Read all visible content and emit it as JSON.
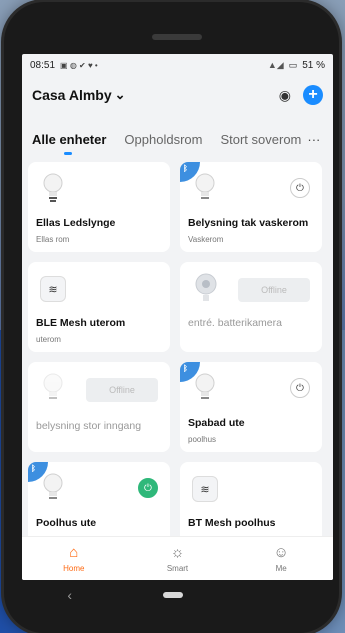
{
  "status": {
    "time": "08:51",
    "notification_icons": "▣ ◍ ✔ ♥ •",
    "signal": "📶",
    "battery": "51 %"
  },
  "header": {
    "home_name": "Casa Almby",
    "chevron": "⌄",
    "location_icon": "◉",
    "add_icon": "+"
  },
  "tabs": [
    {
      "label": "Alle enheter",
      "active": true
    },
    {
      "label": "Oppholdsrom",
      "active": false
    },
    {
      "label": "Stort soverom",
      "active": false
    }
  ],
  "tabs_more": "···",
  "devices": [
    {
      "name": "Ellas Ledslynge",
      "room": "Ellas rom",
      "type": "bulb",
      "bt": false,
      "state": "none"
    },
    {
      "name": "Belysning tak vaskerom",
      "room": "Vaskerom",
      "type": "bulb",
      "bt": true,
      "state": "power-off"
    },
    {
      "name": "BLE Mesh uterom",
      "room": "uterom",
      "type": "gateway",
      "bt": false,
      "state": "none"
    },
    {
      "name": "entré. batterikamera",
      "room": "",
      "type": "camera",
      "bt": false,
      "state": "offline"
    },
    {
      "name": "belysning stor inngang",
      "room": "",
      "type": "bulb",
      "bt": false,
      "state": "offline"
    },
    {
      "name": "Spabad ute",
      "room": "poolhus",
      "type": "bulb",
      "bt": true,
      "state": "power-off"
    },
    {
      "name": "Poolhus ute",
      "room": "",
      "type": "bulb",
      "bt": true,
      "state": "power-on"
    },
    {
      "name": "BT Mesh poolhus",
      "room": "",
      "type": "gateway",
      "bt": false,
      "state": "none"
    }
  ],
  "offline_label": "Offline",
  "nav": [
    {
      "label": "Home",
      "glyph": "⌂",
      "active": true
    },
    {
      "label": "Smart",
      "glyph": "☼",
      "active": false
    },
    {
      "label": "Me",
      "glyph": "☺",
      "active": false
    }
  ],
  "system_keys": {
    "back": "‹"
  },
  "colors": {
    "accent": "#1a8cff",
    "active_nav": "#ff6a13",
    "power_on": "#2fb87a",
    "bt_badge": "#3d8fe0"
  }
}
